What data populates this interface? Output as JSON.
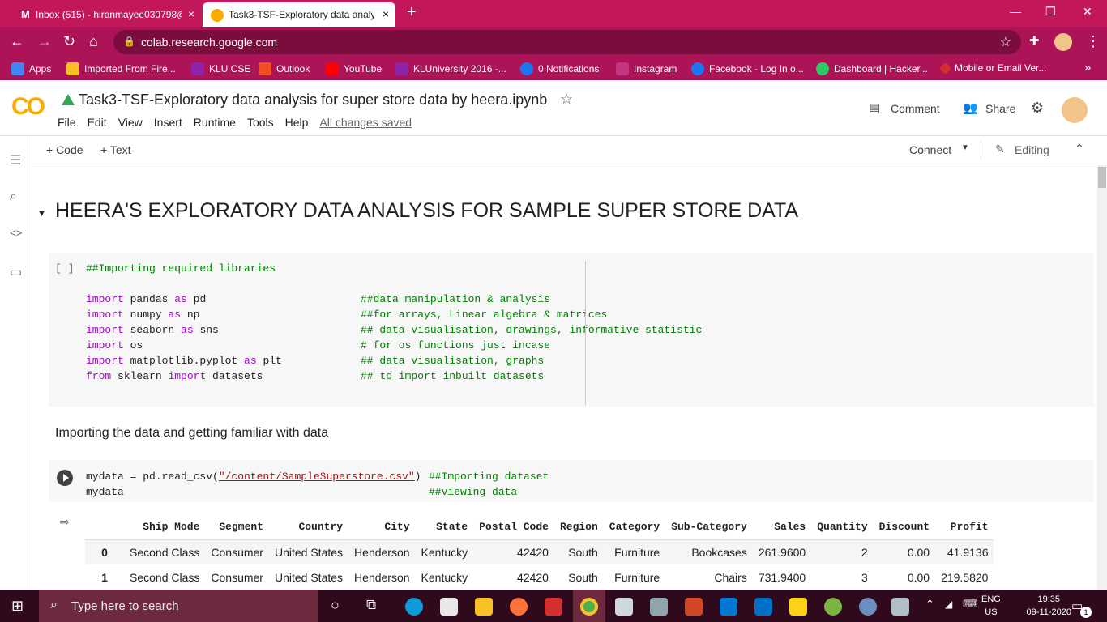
{
  "browser": {
    "tabs": [
      {
        "title": "Inbox (515) - hiranmayee030798@",
        "close": "×"
      },
      {
        "title": "Task3-TSF-Exploratory data analy",
        "close": "×"
      }
    ],
    "new_tab": "+",
    "url": "colab.research.google.com",
    "bookmarks": [
      {
        "label": "Apps",
        "icon": "apps-grid-icon",
        "color": "#4285f4"
      },
      {
        "label": "Imported From Fire...",
        "icon": "folder-icon",
        "color": "#f6c026"
      },
      {
        "label": "KLU CSE",
        "icon": "klu-icon",
        "color": "#8e24aa"
      },
      {
        "label": "Outlook",
        "icon": "outlook-icon",
        "color": "#f25022"
      },
      {
        "label": "YouTube",
        "icon": "youtube-icon",
        "color": "#ff0000"
      },
      {
        "label": "KLUniversity 2016 -...",
        "icon": "klu-icon",
        "color": "#8e24aa"
      },
      {
        "label": "0 Notifications",
        "icon": "facebook-icon",
        "color": "#1877f2"
      },
      {
        "label": "Instagram",
        "icon": "instagram-icon",
        "color": "#c13584"
      },
      {
        "label": "Facebook - Log In o...",
        "icon": "facebook-icon",
        "color": "#1877f2"
      },
      {
        "label": "Dashboard | Hacker...",
        "icon": "hackerrank-icon",
        "color": "#2ec866"
      },
      {
        "label": "Mobile or Email Ver...",
        "icon": "diamond-icon",
        "color": "#d32f2f"
      }
    ],
    "more": "»"
  },
  "colab": {
    "logo": "CO",
    "title": "Task3-TSF-Exploratory data analysis for super store data by heera.ipynb",
    "menu": [
      "File",
      "Edit",
      "View",
      "Insert",
      "Runtime",
      "Tools",
      "Help"
    ],
    "saved_status": "All changes saved",
    "comment": "Comment",
    "share": "Share",
    "add_code": "+ Code",
    "add_text": "+ Text",
    "connect": "Connect",
    "editing": "Editing"
  },
  "notebook": {
    "heading": "HEERA'S EXPLORATORY DATA ANALYSIS FOR SAMPLE SUPER STORE DATA",
    "cell1_prompt": "[ ]",
    "cell1_comment": "##Importing required libraries",
    "imports": [
      {
        "kw1": "import",
        "mod": " pandas ",
        "kw2": "as",
        "alias": " pd",
        "comment": "##data manipulation & analysis"
      },
      {
        "kw1": "import",
        "mod": " numpy ",
        "kw2": "as",
        "alias": " np",
        "comment": "##for arrays, Linear algebra & matrices"
      },
      {
        "kw1": "import",
        "mod": " seaborn ",
        "kw2": "as",
        "alias": " sns",
        "comment": "## data visualisation, drawings, informative statistic"
      },
      {
        "kw1": "import",
        "mod": " os",
        "kw2": "",
        "alias": "",
        "comment": "# for os functions just incase"
      },
      {
        "kw1": "import",
        "mod": " matplotlib.pyplot ",
        "kw2": "as",
        "alias": " plt",
        "comment": "## data visualisation, graphs"
      },
      {
        "kw1": "from",
        "mod": " sklearn ",
        "kw2": "import",
        "alias": " datasets",
        "comment": "## to import inbuilt datasets"
      }
    ],
    "markdown": "Importing the data and getting familiar with data",
    "cell2_line1_pre": "mydata = pd.read_csv(",
    "cell2_line1_str": "\"/content/SampleSuperstore.csv\"",
    "cell2_line1_post": ")",
    "cell2_line1_comment": "##Importing dataset",
    "cell2_line2": "mydata",
    "cell2_line2_comment": "##viewing data",
    "table": {
      "columns": [
        "",
        "Ship Mode",
        "Segment",
        "Country",
        "City",
        "State",
        "Postal Code",
        "Region",
        "Category",
        "Sub-Category",
        "Sales",
        "Quantity",
        "Discount",
        "Profit"
      ],
      "rows": [
        [
          "0",
          "Second Class",
          "Consumer",
          "United States",
          "Henderson",
          "Kentucky",
          "42420",
          "South",
          "Furniture",
          "Bookcases",
          "261.9600",
          "2",
          "0.00",
          "41.9136"
        ],
        [
          "1",
          "Second Class",
          "Consumer",
          "United States",
          "Henderson",
          "Kentucky",
          "42420",
          "South",
          "Furniture",
          "Chairs",
          "731.9400",
          "3",
          "0.00",
          "219.5820"
        ]
      ]
    }
  },
  "taskbar": {
    "search_placeholder": "Type here to search",
    "lang": "ENG",
    "region": "US",
    "time": "19:35",
    "date": "09-11-2020",
    "notif_count": "1"
  }
}
